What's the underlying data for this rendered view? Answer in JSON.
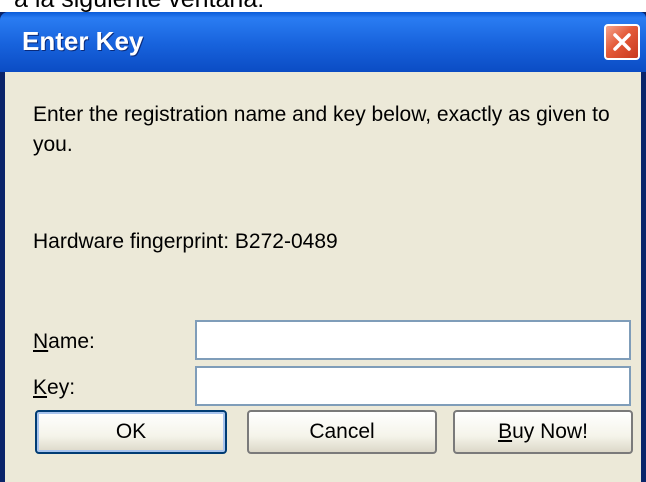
{
  "caption_fragment": "a la siguiente ventana:",
  "window": {
    "title": "Enter Key",
    "close_icon": "close-x-icon"
  },
  "dialog": {
    "message": "Enter the registration name and key below, exactly as given to you.",
    "fingerprint": "Hardware fingerprint: B272-0489",
    "fields": {
      "name_label_accel": "N",
      "name_label_rest": "ame:",
      "name_value": "",
      "key_label_accel": "K",
      "key_label_rest": "ey:",
      "key_value": ""
    },
    "buttons": {
      "ok": "OK",
      "cancel": "Cancel",
      "buy_accel": "B",
      "buy_rest": "uy Now!"
    }
  },
  "colors": {
    "titlebar": "#1762dc",
    "body": "#ece9d8",
    "close": "#e45a38",
    "input_border": "#7f9db9"
  }
}
